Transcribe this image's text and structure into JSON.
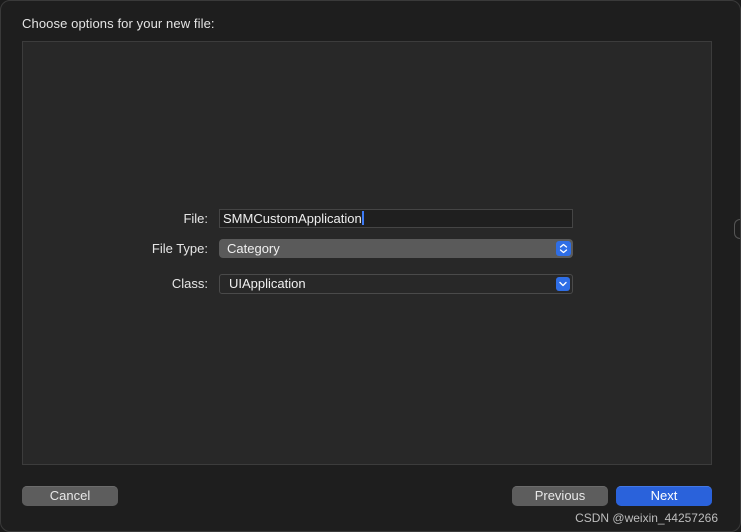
{
  "dialog": {
    "title": "Choose options for your new file:"
  },
  "form": {
    "file": {
      "label": "File:",
      "value": "SMMCustomApplication"
    },
    "file_type": {
      "label": "File Type:",
      "selected": "Category",
      "icon": "up-down-chevron-icon"
    },
    "class": {
      "label": "Class:",
      "value": "UIApplication",
      "icon": "chevron-down-icon"
    }
  },
  "buttons": {
    "cancel": "Cancel",
    "previous": "Previous",
    "next": "Next"
  },
  "watermark": "CSDN @weixin_44257266",
  "colors": {
    "accent": "#2a62db",
    "background": "#1e1e1e",
    "panel": "#282828"
  }
}
